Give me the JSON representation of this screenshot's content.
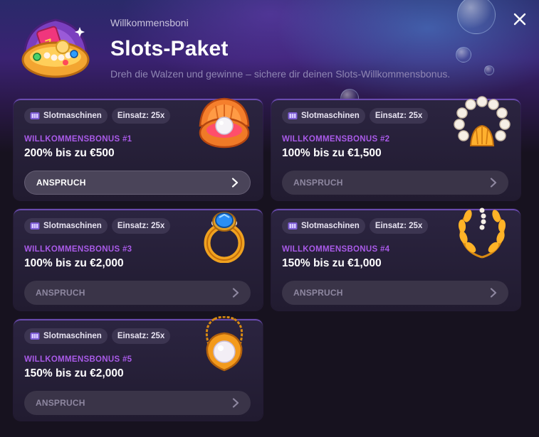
{
  "header": {
    "eyebrow": "Willkommensboni",
    "title": "Slots-Paket",
    "subtitle": "Dreh die Walzen und gewinne – sichere dir deinen Slots-Willkommensbonus."
  },
  "cards": [
    {
      "tag_game": "Slotmaschinen",
      "tag_wager": "Einsatz: 25x",
      "label": "WILLKOMMENSBONUS #1",
      "amount": "200% bis zu €500",
      "button": "ANSPRUCH",
      "state": "active",
      "art": "pearl-clam-icon"
    },
    {
      "tag_game": "Slotmaschinen",
      "tag_wager": "Einsatz: 25x",
      "label": "WILLKOMMENSBONUS #2",
      "amount": "100% bis zu €1,500",
      "button": "ANSPRUCH",
      "state": "disabled",
      "art": "pearl-bracelet-icon"
    },
    {
      "tag_game": "Slotmaschinen",
      "tag_wager": "Einsatz: 25x",
      "label": "WILLKOMMENSBONUS #3",
      "amount": "100% bis zu €2,000",
      "button": "ANSPRUCH",
      "state": "disabled",
      "art": "gem-ring-icon"
    },
    {
      "tag_game": "Slotmaschinen",
      "tag_wager": "Einsatz: 25x",
      "label": "WILLKOMMENSBONUS #4",
      "amount": "150% bis zu €1,000",
      "button": "ANSPRUCH",
      "state": "disabled",
      "art": "golden-wreath-icon"
    },
    {
      "tag_game": "Slotmaschinen",
      "tag_wager": "Einsatz: 25x",
      "label": "WILLKOMMENSBONUS #5",
      "amount": "150% bis zu €2,000",
      "button": "ANSPRUCH",
      "state": "disabled",
      "art": "pearl-pendant-icon"
    }
  ],
  "colors": {
    "accent_label": "#a95ae8",
    "card_border": "#6a4bb0",
    "background": "#17121f"
  }
}
